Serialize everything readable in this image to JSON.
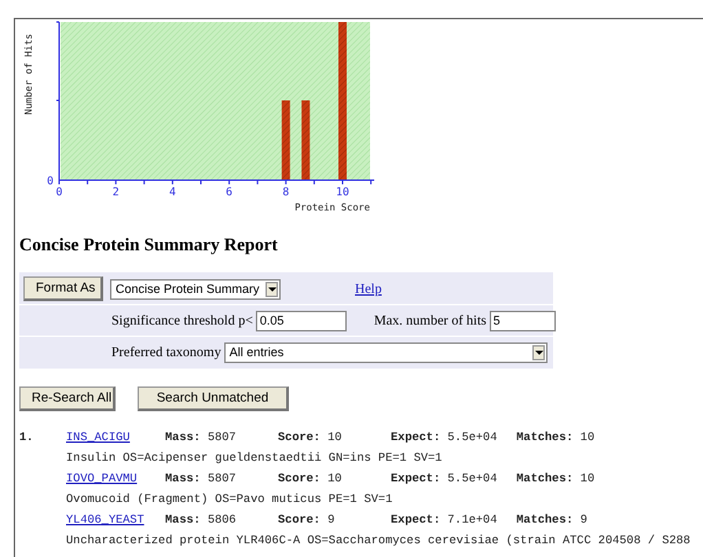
{
  "histogram": {
    "ylabel": "Number of Hits",
    "xlabel": "Protein Score",
    "x_tick_labels": [
      "0",
      "2",
      "4",
      "6",
      "8",
      "10"
    ],
    "y_tick_labels": [
      "0"
    ]
  },
  "report_title": "Concise Protein Summary Report",
  "format_form": {
    "format_button": "Format As",
    "format_select": "Concise Protein Summary",
    "help_link": "Help",
    "threshold_label": "Significance threshold p<",
    "threshold_value": "0.05",
    "max_hits_label": "Max. number of hits",
    "max_hits_value": "5",
    "taxonomy_label": "Preferred taxonomy",
    "taxonomy_select": "All entries"
  },
  "buttons": [
    "Re-Search All",
    "Search Unmatched"
  ],
  "hits": [
    {
      "number": "1.",
      "proteins": [
        {
          "accession": "INS_ACIGU",
          "fields": [
            "**Mass:** 5807",
            "**Score:** 10",
            "**Expect:** 5.5e+04",
            "**Matches:** 10"
          ],
          "description": "Insulin OS=Acipenser gueldenstaedtii GN=ins PE=1 SV=1"
        },
        {
          "accession": "IOVO_PAVMU",
          "fields": [
            "**Mass:** 5807",
            "**Score:** 10",
            "**Expect:** 5.5e+04",
            "**Matches:** 10"
          ],
          "description": "Ovomucoid (Fragment) OS=Pavo muticus PE=1 SV=1"
        },
        {
          "accession": "YL406_YEAST",
          "fields": [
            "**Mass:** 5806",
            "**Score:** 9",
            "**Expect:** 7.1e+04",
            "**Matches:** 9"
          ],
          "description": "Uncharacterized protein YLR406C-A OS=Saccharomyces cerevisiae (strain ATCC 204508 / S288"
        }
      ]
    }
  ]
}
